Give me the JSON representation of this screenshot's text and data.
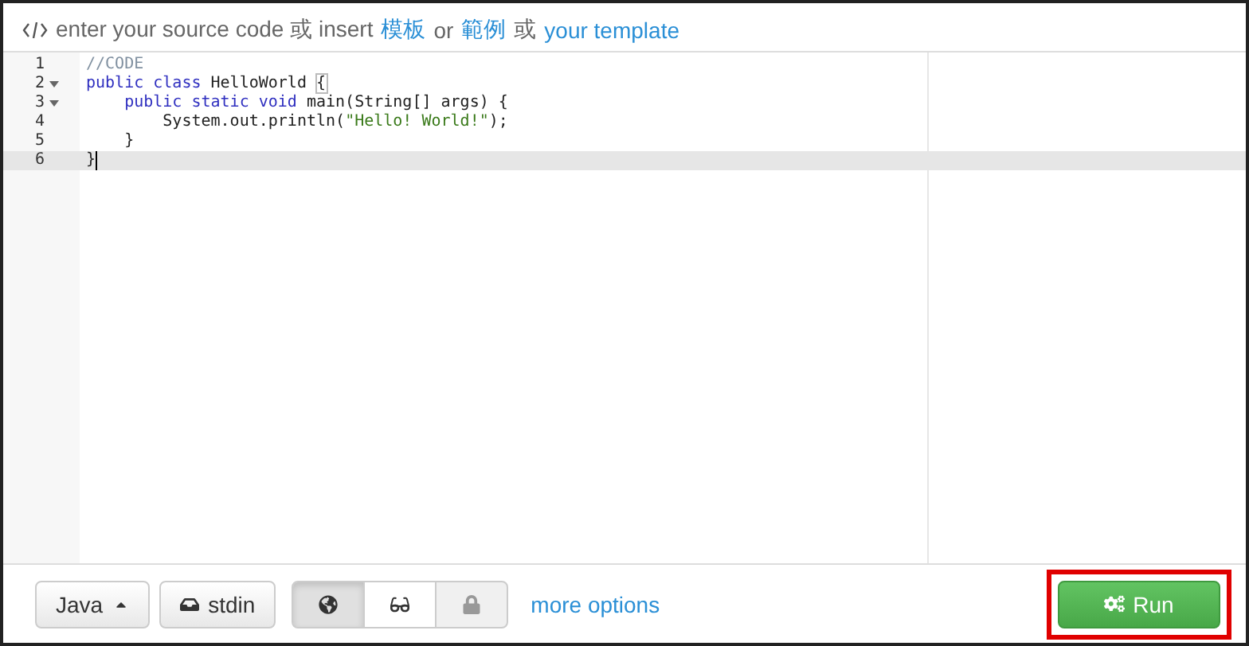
{
  "header": {
    "parts": [
      {
        "text": "enter your source code 或 insert",
        "kind": "plain"
      },
      {
        "text": "模板",
        "kind": "link"
      },
      {
        "text": "or",
        "kind": "plain"
      },
      {
        "text": "範例",
        "kind": "link"
      },
      {
        "text": "或",
        "kind": "plain"
      },
      {
        "text": "your template",
        "kind": "link"
      }
    ]
  },
  "editor": {
    "lines": [
      {
        "number": "1",
        "foldable": false,
        "active": false,
        "tokens": [
          {
            "text": "//CODE",
            "kind": "comment"
          }
        ]
      },
      {
        "number": "2",
        "foldable": true,
        "active": false,
        "tokens": [
          {
            "text": "public class",
            "kind": "keyword"
          },
          {
            "text": " HelloWorld ",
            "kind": "plain"
          },
          {
            "text": "{",
            "kind": "matched"
          }
        ]
      },
      {
        "number": "3",
        "foldable": true,
        "active": false,
        "tokens": [
          {
            "text": "    public static void",
            "kind": "keyword"
          },
          {
            "text": " main(String[] args) {",
            "kind": "plain"
          }
        ]
      },
      {
        "number": "4",
        "foldable": false,
        "active": false,
        "tokens": [
          {
            "text": "        System.out.println(",
            "kind": "plain"
          },
          {
            "text": "\"Hello! World!\"",
            "kind": "string"
          },
          {
            "text": ");",
            "kind": "plain"
          }
        ]
      },
      {
        "number": "5",
        "foldable": false,
        "active": false,
        "tokens": [
          {
            "text": "    }",
            "kind": "plain"
          }
        ]
      },
      {
        "number": "6",
        "foldable": false,
        "active": true,
        "tokens": [
          {
            "text": "}",
            "kind": "plain"
          }
        ]
      }
    ]
  },
  "toolbar": {
    "language": "Java",
    "stdin": "stdin",
    "modes": [
      {
        "kind": "globe",
        "selected": true,
        "disabled": false
      },
      {
        "kind": "glasses",
        "selected": false,
        "disabled": false
      },
      {
        "kind": "lock",
        "selected": false,
        "disabled": true
      }
    ],
    "more_options": "more options",
    "run": "Run",
    "run_highlighted": true
  }
}
